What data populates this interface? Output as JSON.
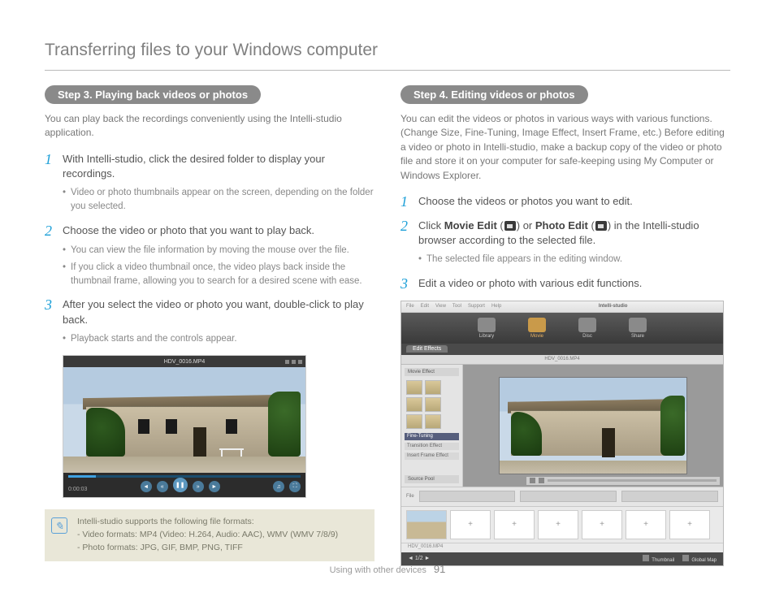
{
  "title": "Transferring files to your Windows computer",
  "footer": {
    "section": "Using with other devices",
    "page": "91"
  },
  "left": {
    "step_label": "Step 3. Playing back videos or photos",
    "intro": "You can play back the recordings conveniently using the Intelli-studio application.",
    "items": [
      {
        "num": "1",
        "text": "With Intelli-studio, click the desired folder to display your recordings.",
        "bullets": [
          "Video or photo thumbnails appear on the screen, depending on the folder you selected."
        ]
      },
      {
        "num": "2",
        "text": "Choose the video or photo that you want to play back.",
        "bullets": [
          "You can view the file information by moving the mouse over the file.",
          "If you click a video thumbnail once, the video plays back inside the thumbnail frame, allowing you to search for a desired scene with ease."
        ]
      },
      {
        "num": "3",
        "text": "After you select the video or photo you want, double-click to play back.",
        "bullets": [
          "Playback starts and the controls appear."
        ]
      }
    ],
    "player_title": "HDV_0016.MP4",
    "note": {
      "l1": "Intelli-studio supports the following file formats:",
      "l2": "- Video formats: MP4 (Video: H.264, Audio: AAC), WMV (WMV 7/8/9)",
      "l3": "- Photo formats: JPG, GIF, BMP, PNG, TIFF"
    }
  },
  "right": {
    "step_label": "Step 4. Editing videos or photos",
    "intro": "You can edit the videos or photos in various ways with various functions. (Change Size, Fine-Tuning, Image Effect, Insert Frame, etc.) Before editing a video or photo in Intelli-studio, make a backup copy of the video or photo file and store it on your computer for safe-keeping using My Computer or Windows Explorer.",
    "items": [
      {
        "num": "1",
        "text": "Choose the videos or photos you want to edit."
      },
      {
        "num": "2",
        "pre": "Click ",
        "b1": "Movie Edit",
        "mid1": " (",
        "icon1": "movie-edit-icon",
        "mid2": ") or ",
        "b2": "Photo Edit",
        "mid3": " (",
        "icon2": "photo-edit-icon",
        "post": ") in the Intelli-studio browser according to the selected file.",
        "bullets": [
          "The selected file appears in the editing window."
        ]
      },
      {
        "num": "3",
        "text": "Edit a video or photo with various edit functions."
      }
    ],
    "editor": {
      "app_name": "Intelli-studio",
      "menus": [
        "File",
        "Edit",
        "View",
        "Tool",
        "Support",
        "Help"
      ],
      "modes": [
        "Library",
        "Movie",
        "Disc",
        "Share"
      ],
      "tab": "Edit Effects",
      "filename": "HDV_0016.MP4",
      "side_head": "Movie Effect",
      "side_rows": [
        "Fine-Tuning",
        "Transition Effect",
        "Insert Frame Effect"
      ],
      "source": "Source Pool",
      "thumb_lbl": "HDV_0016.MP4",
      "footer": {
        "a": "Thumbnail",
        "b": "Global Map"
      }
    }
  }
}
